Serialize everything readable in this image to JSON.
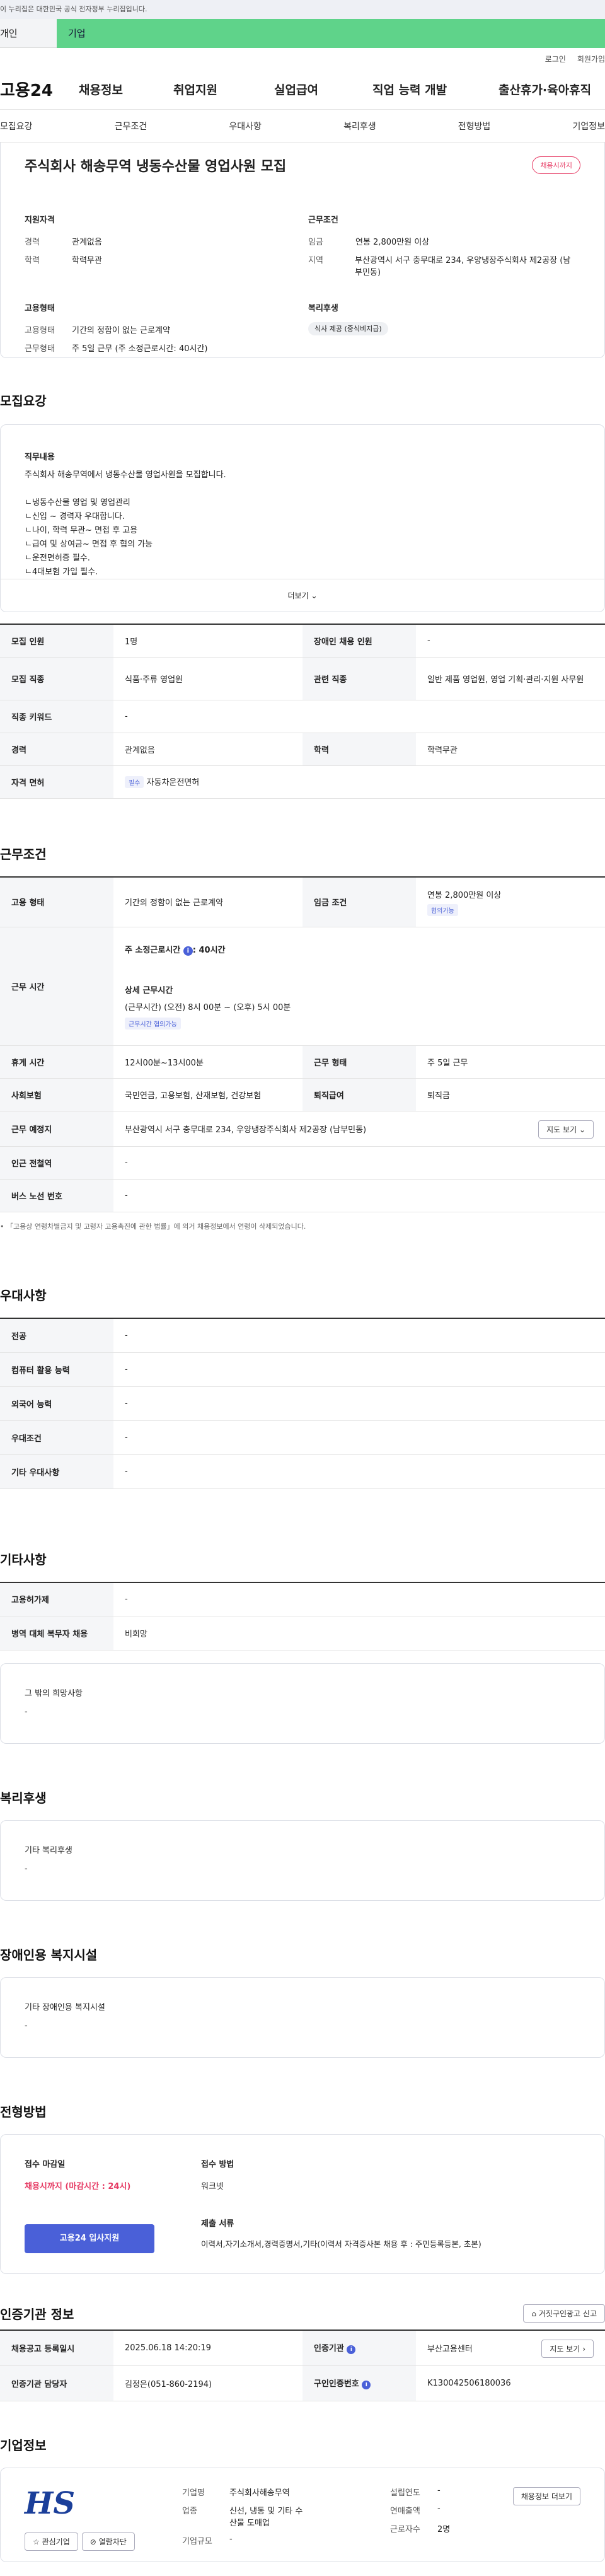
{
  "gov_banner": "이 누리집은 대한민국 공식 전자정부 누리집입니다.",
  "user_tabs": [
    "개인",
    "기업"
  ],
  "top_links": [
    "로그인",
    "회원가입"
  ],
  "logo": "고용24",
  "gnb": [
    "채용정보",
    "취업지원",
    "실업급여",
    "직업 능력 개발",
    "출산휴가·육아휴직"
  ],
  "snb": [
    "모집요강",
    "근무조건",
    "우대사항",
    "복리후생",
    "전형방법",
    "기업정보"
  ],
  "title": "주식회사 해송무역 냉동수산물 영업사원 모집",
  "status_badge": "채용시까지",
  "summary": {
    "qual_title": "지원자격",
    "qual": [
      [
        "경력",
        "관계없음"
      ],
      [
        "학력",
        "학력무관"
      ]
    ],
    "work_title": "근무조건",
    "work": [
      [
        "임금",
        "연봉 2,800만원 이상"
      ],
      [
        "지역",
        "부산광역시 서구 충무대로 234, 우양냉장주식회사 제2공장 (남부민동)"
      ]
    ],
    "emp_title": "고용형태",
    "emp": [
      [
        "고용형태",
        "기간의 정함이 없는 근로계약"
      ],
      [
        "근무형태",
        "주 5일 근무 (주 소정근로시간: 40시간)"
      ]
    ],
    "welfare_title": "복리후생",
    "welfare_tag": "식사 제공 (중식비지급)"
  },
  "recruit": {
    "title": "모집요강",
    "duty_label": "직무내용",
    "duty_lines": [
      "주식회사 해송무역에서 냉동수산물 영업사원을 모집합니다.",
      "",
      "ㄴ냉동수산물 영업 및 영업관리",
      "ㄴ신입 ~ 경력자 우대합니다.",
      "ㄴ나이, 학력 무관~ 면접 후 고용",
      "ㄴ급여 및 상여금~ 면접 후 협의 가능",
      "ㄴ운전면허증 필수.",
      "ㄴ4대보험 가입 필수."
    ],
    "more": "더보기",
    "rows": [
      [
        "모집 인원",
        "1명",
        "장애인 채용 인원",
        "-"
      ],
      [
        "모집 직종",
        "식품·주류 영업원",
        "관련 직종",
        "일반 제품 영업원, 영업 기획·관리·지원 사무원"
      ],
      [
        "직종 키워드",
        "-"
      ],
      [
        "경력",
        "관계없음",
        "학력",
        "학력무관"
      ]
    ],
    "license_label": "자격 면허",
    "license_tag": "필수",
    "license": "자동차운전면허"
  },
  "conditions": {
    "title": "근무조건",
    "emp_type_label": "고용 형태",
    "emp_type": "기간의 정함이 없는 근로계약",
    "wage_label": "임금 조건",
    "wage": "연봉 2,800만원 이상",
    "wage_tag": "협의가능",
    "hours_label": "근무 시간",
    "hours_week": "주 소정근로시간",
    "hours_badge": "i",
    "hours_val": ": 40시간",
    "hours_detail_label": "상세 근무시간",
    "hours_detail": "(근무시간) (오전) 8시 00분 ~ (오후) 5시 00분",
    "hours_tag": "근무시간 협의가능",
    "break_label": "휴게 시간",
    "break": "12시00분~13시00분",
    "form_label": "근무 형태",
    "form": "주 5일 근무",
    "ins_label": "사회보험",
    "ins": "국민연금, 고용보험, 산재보험, 건강보험",
    "ret_label": "퇴직급여",
    "ret": "퇴직금",
    "place_label": "근무 예정지",
    "place": "부산광역시 서구 충무대로 234, 우양냉장주식회사 제2공장 (남부민동)",
    "map_btn": "지도 보기",
    "station_label": "인근 전철역",
    "station": "-",
    "bus_label": "버스 노선 번호",
    "bus": "-",
    "notice": "「고용상 연령차별금지 및 고령자 고용촉진에 관한 법률」에 의거 채용정보에서 연령이 삭제되었습니다."
  },
  "pref": {
    "title": "우대사항",
    "rows": [
      [
        "전공",
        "-"
      ],
      [
        "컴퓨터 활용 능력",
        "-"
      ],
      [
        "외국어 능력",
        "-"
      ],
      [
        "우대조건",
        "-"
      ],
      [
        "기타 우대사항",
        "-"
      ]
    ]
  },
  "etc": {
    "title": "기타사항",
    "rows": [
      [
        "고용허가제",
        "-"
      ],
      [
        "병역 대체 복무자 채용",
        "비희망"
      ]
    ],
    "other_label": "그 밖의 희망사항",
    "other": "-"
  },
  "welfare": {
    "title": "복리후생",
    "label": "기타 복리후생",
    "value": "-"
  },
  "disab": {
    "title": "장애인용 복지시설",
    "label": "기타 장애인용 복지시설",
    "value": "-"
  },
  "process": {
    "title": "전형방법",
    "deadline_label": "접수 마감일",
    "deadline": "채용시까지 (마감시간 : 24시)",
    "apply_btn": "고용24 입사지원",
    "method_label": "접수 방법",
    "method": "워크넷",
    "docs_label": "제출 서류",
    "docs": "이력서,자기소개서,경력증명서,기타(이력서 자격증사본 채용 후 : 주민등록등본, 초본)"
  },
  "agency": {
    "title": "인증기관 정보",
    "report_btn": "거짓구인광고 신고",
    "reg_label": "채용공고 등록일시",
    "reg": "2025.06.18 14:20:19",
    "org_label": "인증기관",
    "org": "부산고용센터",
    "map_btn": "지도 보기",
    "mgr_label": "인증기관 담당자",
    "mgr": "김정은(051-860-2194)",
    "no_label": "구인인증번호",
    "no": "K130042506180036"
  },
  "company": {
    "title": "기업정보",
    "logo_text": "HS",
    "fav_btn": "관심기업",
    "block_btn": "열람차단",
    "info_btn": "채용정보 더보기",
    "name_label": "기업명",
    "name": "주식회사해송무역",
    "ind_label": "업종",
    "ind": "신선, 냉동 및 기타 수산물 도매업",
    "size_label": "기업규모",
    "size": "-",
    "year_label": "설립연도",
    "year": "-",
    "sales_label": "연매출액",
    "sales": "-",
    "emp_label": "근로자수",
    "emp": "2명"
  },
  "colors": {
    "accent": "#4a60d8",
    "green": "#5fd38a",
    "red": "#e63b64"
  }
}
